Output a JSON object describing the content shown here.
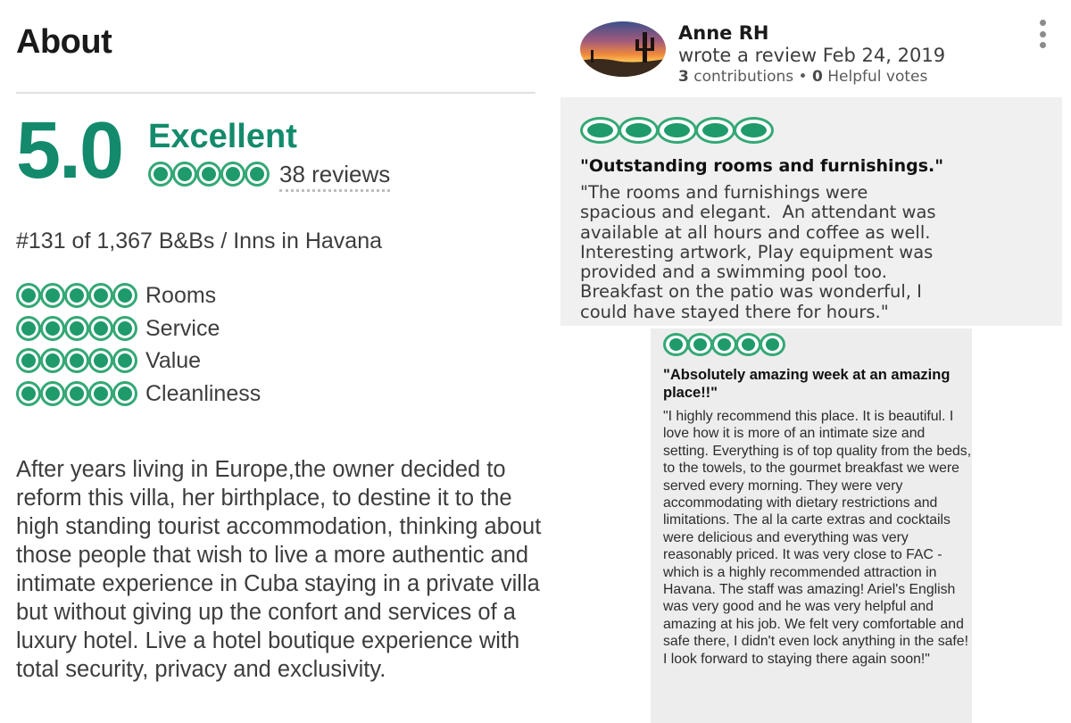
{
  "about": {
    "title": "About",
    "score": "5.0",
    "rating_word": "Excellent",
    "bubble_rating": 5,
    "review_count": "38 reviews",
    "ranking": "#131 of 1,367 B&Bs / Inns in Havana",
    "subratings": [
      {
        "label": "Rooms",
        "bubbles": 5
      },
      {
        "label": "Service",
        "bubbles": 5
      },
      {
        "label": "Value",
        "bubbles": 5
      },
      {
        "label": "Cleanliness",
        "bubbles": 5
      }
    ],
    "description": "After years living in Europe,the owner decided to reform this villa, her birthplace, to destine it to the high standing tourist accommodation, thinking about those people that wish to live a more authentic and intimate experience in Cuba staying in a private villa but without giving up the confort and services of a luxury hotel. Live a hotel boutique experience with total security, privacy and exclusivity."
  },
  "review1": {
    "reviewer_name": "Anne RH",
    "meta": "wrote a review Feb 24, 2019",
    "contributions_count": "3",
    "contributions_label": "contributions",
    "helpful_count": "0",
    "helpful_label": "Helpful votes",
    "bubble_rating": 5,
    "title": "\"Outstanding rooms and furnishings.\"",
    "body_lines": [
      "\"The rooms and furnishings were",
      "spacious and elegant.  An attendant was",
      "available at all hours and coffee as well.",
      "Interesting artwork, Play equipment was",
      "provided and a swimming pool too.",
      "Breakfast on the patio was wonderful, I",
      "could have stayed there for hours.\""
    ]
  },
  "review2": {
    "bubble_rating": 5,
    "title": "\"Absolutely amazing week at an amazing place!!\"",
    "body": "\"I highly recommend this place. It is beautiful. I love how it is more of an intimate size and setting. Everything is of top quality from the beds, to the towels, to the gourmet breakfast we were served every morning. They were very accommodating with dietary restrictions and limitations. The al la carte extras and cocktails were delicious and everything was very reasonably priced. It was very close to FAC - which is a highly recommended attraction in Havana. The staff was amazing! Ariel's English was very good and he was very helpful and amazing at his job. We felt very comfortable and safe there, I didn't even lock anything in the safe! I look forward to staying there again soon!\""
  },
  "colors": {
    "brand_green": "#138a6c",
    "bubble_fill": "#1f9a6b",
    "text": "#3d3d3d",
    "review_bg": "#f0f0f0"
  },
  "icons": [
    "bubble-rating-icon",
    "more-options-icon",
    "avatar-sunset-cactus"
  ]
}
